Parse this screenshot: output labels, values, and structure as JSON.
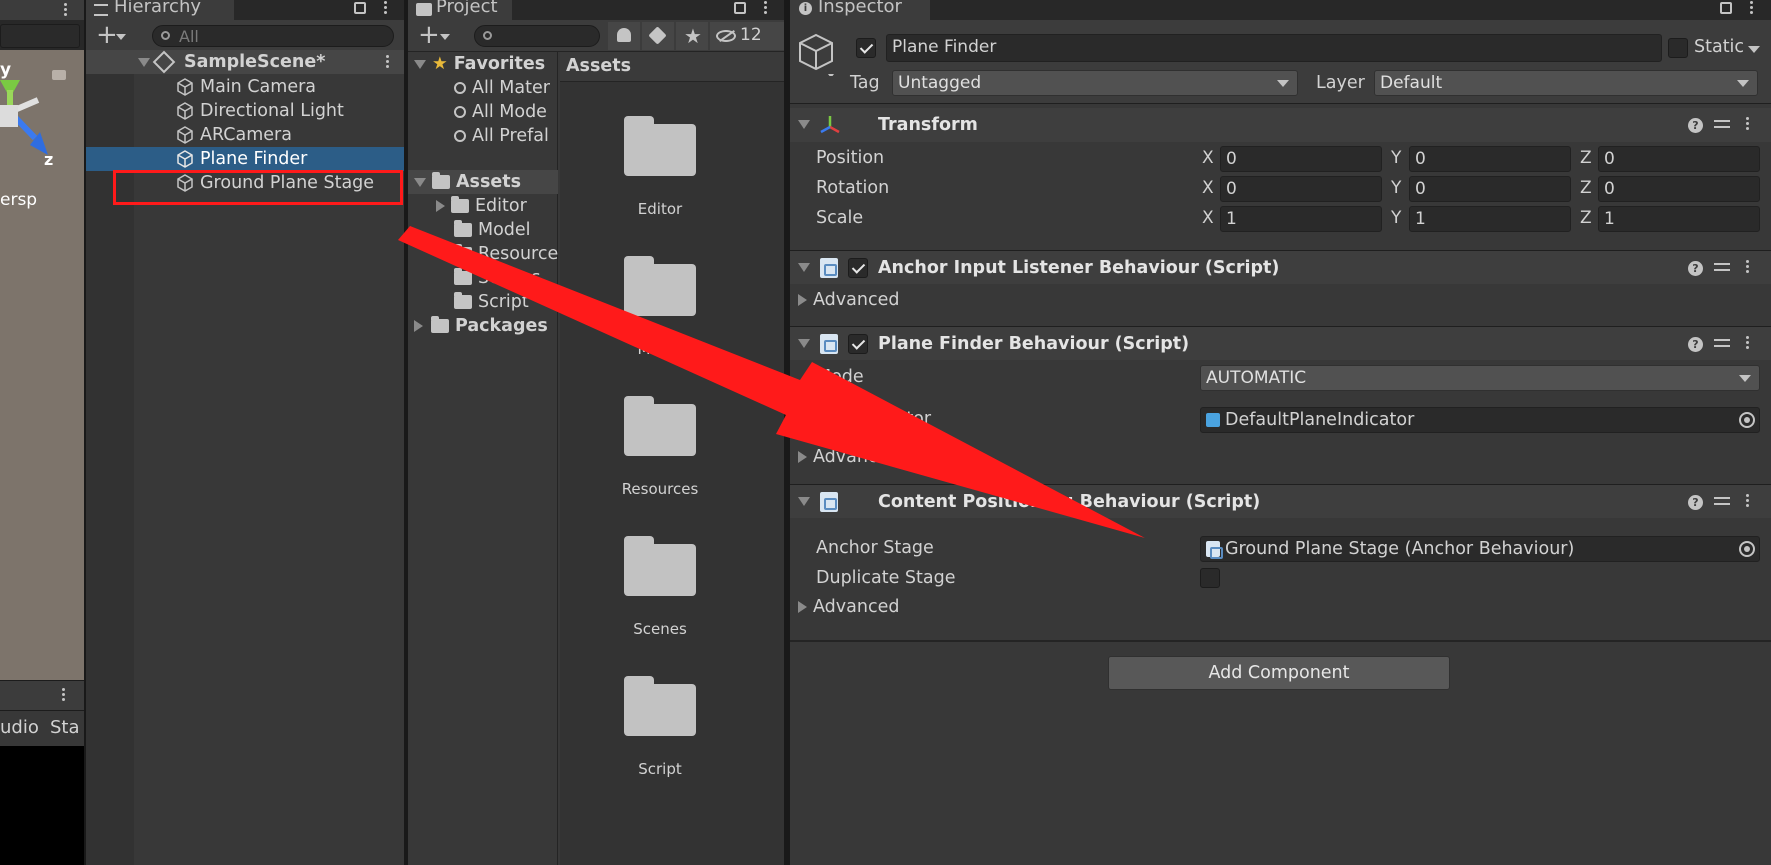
{
  "colors": {
    "accent_selection": "#2c5d87",
    "annotation_red": "#ff1a1a",
    "panel_bg": "#383838",
    "dark_bg": "#282828"
  },
  "scene_view": {
    "gizmo_label_y": "y",
    "gizmo_label_z": "z",
    "persp_label": "ersp",
    "bottom_tabs": [
      "udio",
      "Sta"
    ]
  },
  "hierarchy": {
    "tab_label": "Hierarchy",
    "search_placeholder": "All",
    "scene_name": "SampleScene*",
    "items": [
      "Main Camera",
      "Directional Light",
      "ARCamera",
      "Plane Finder",
      "Ground Plane Stage"
    ]
  },
  "project": {
    "tab_label": "Project",
    "hidden_count": "12",
    "favorites_label": "Favorites",
    "favorites": [
      "All Mater",
      "All Mode",
      "All Prefal"
    ],
    "assets_label": "Assets",
    "asset_folders": [
      "Editor",
      "Model",
      "Resource",
      "Scenes",
      "Script"
    ],
    "packages_label": "Packages",
    "grid_header": "Assets",
    "grid_folders": [
      "Editor",
      "Model",
      "Resources",
      "Scenes",
      "Script"
    ]
  },
  "inspector": {
    "tab_label": "Inspector",
    "object_name": "Plane Finder",
    "static_label": "Static",
    "tag_label": "Tag",
    "tag_value": "Untagged",
    "layer_label": "Layer",
    "layer_value": "Default",
    "transform": {
      "title": "Transform",
      "rows": [
        {
          "label": "Position",
          "x": "0",
          "y": "0",
          "z": "0"
        },
        {
          "label": "Rotation",
          "x": "0",
          "y": "0",
          "z": "0"
        },
        {
          "label": "Scale",
          "x": "1",
          "y": "1",
          "z": "1"
        }
      ]
    },
    "anchor_input": {
      "title": "Anchor Input Listener Behaviour (Script)",
      "advanced": "Advanced"
    },
    "plane_finder": {
      "title": "Plane Finder Behaviour (Script)",
      "mode_label": "Mode",
      "mode_value": "AUTOMATIC",
      "indicator_label": "dicator",
      "indicator_value": "DefaultPlaneIndicator",
      "advanced": "Advanced"
    },
    "content_positioning": {
      "title": "Content Positioning Behaviour (Script)",
      "anchor_stage_label": "Anchor Stage",
      "anchor_stage_value": "Ground Plane Stage (Anchor Behaviour)",
      "duplicate_stage_label": "Duplicate Stage",
      "advanced": "Advanced"
    },
    "add_component": "Add Component"
  }
}
